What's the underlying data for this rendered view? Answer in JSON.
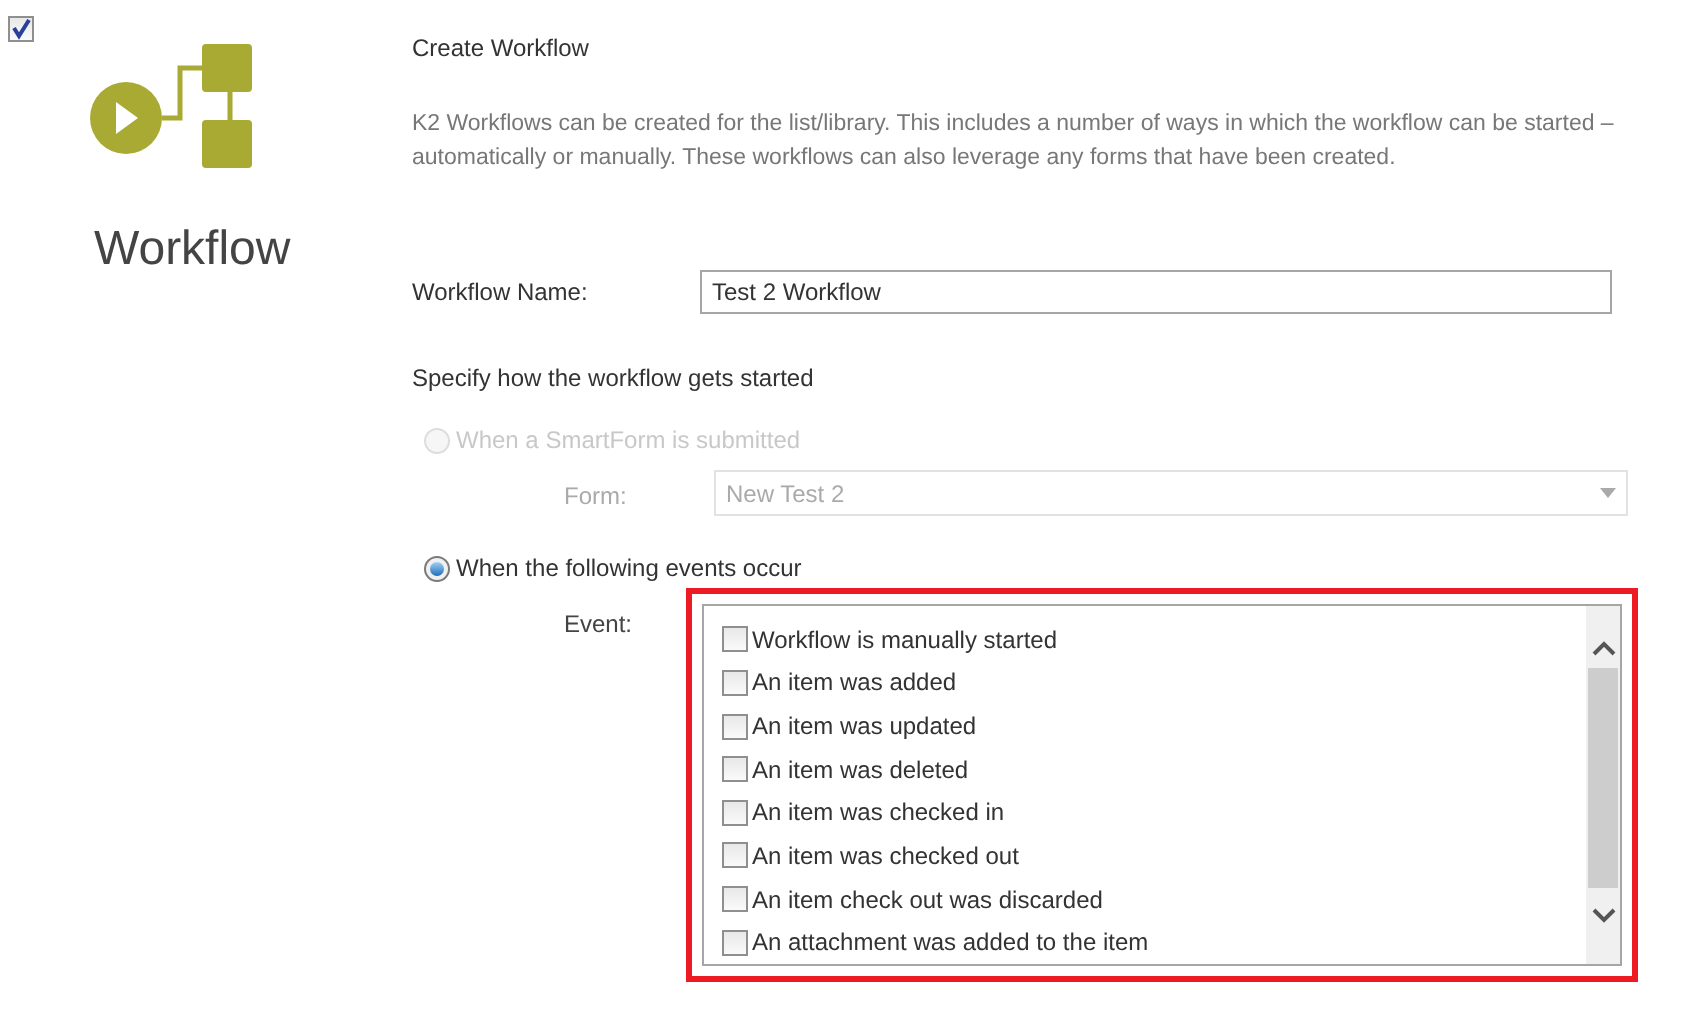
{
  "section": {
    "checked": true,
    "title": "Workflow"
  },
  "header": {
    "title": "Create Workflow",
    "description": "K2 Workflows can be created for the list/library.  This includes a number of ways in which the workflow can be started – automatically or manually.  These workflows can also leverage any forms that have been created."
  },
  "workflow_name": {
    "label": "Workflow Name:",
    "value": "Test 2 Workflow"
  },
  "start_heading": "Specify how the workflow gets started",
  "start_options": [
    {
      "label": "When a SmartForm is submitted",
      "selected": false,
      "disabled": true,
      "field_label": "Form:",
      "kind": "select",
      "value": "New Test 2"
    },
    {
      "label": "When the following events occur",
      "selected": true,
      "disabled": false,
      "field_label": "Event:",
      "kind": "checklist",
      "highlighted": true,
      "events": [
        {
          "label": "Workflow is manually started",
          "checked": false
        },
        {
          "label": "An item was added",
          "checked": false
        },
        {
          "label": "An item was updated",
          "checked": false
        },
        {
          "label": "An item was deleted",
          "checked": false
        },
        {
          "label": "An item was checked in",
          "checked": false
        },
        {
          "label": "An item was checked out",
          "checked": false
        },
        {
          "label": "An item check out was discarded",
          "checked": false
        },
        {
          "label": "An attachment was added to the item",
          "checked": false
        }
      ]
    }
  ]
}
